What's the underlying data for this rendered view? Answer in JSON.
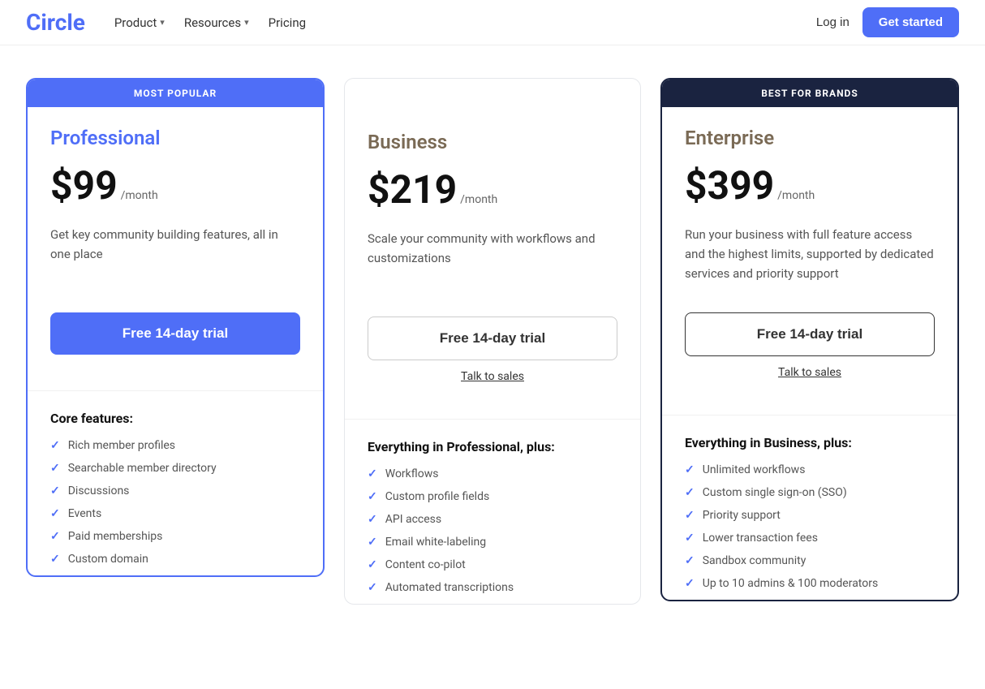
{
  "nav": {
    "logo": "Circle",
    "links": [
      {
        "label": "Product",
        "has_dropdown": true
      },
      {
        "label": "Resources",
        "has_dropdown": true
      },
      {
        "label": "Pricing",
        "has_dropdown": false
      }
    ],
    "login_label": "Log in",
    "get_started_label": "Get started"
  },
  "plans": [
    {
      "id": "professional",
      "badge": "MOST POPULAR",
      "badge_type": "popular",
      "name": "Professional",
      "price": "$99",
      "period": "/month",
      "description": "Get key community building features, all in one place",
      "cta_primary": "Free 14-day trial",
      "cta_type": "primary",
      "talk_to_sales": null,
      "features_heading": "Core features:",
      "features": [
        "Rich member profiles",
        "Searchable member directory",
        "Discussions",
        "Events",
        "Paid memberships",
        "Custom domain"
      ]
    },
    {
      "id": "business",
      "badge": null,
      "badge_type": "none",
      "name": "Business",
      "price": "$219",
      "period": "/month",
      "description": "Scale your community with workflows and customizations",
      "cta_primary": "Free 14-day trial",
      "cta_type": "secondary",
      "talk_to_sales": "Talk to sales",
      "features_heading": "Everything in Professional, plus:",
      "features": [
        "Workflows",
        "Custom profile fields",
        "API access",
        "Email white-labeling",
        "Content co-pilot",
        "Automated transcriptions"
      ]
    },
    {
      "id": "enterprise",
      "badge": "BEST FOR BRANDS",
      "badge_type": "enterprise",
      "name": "Enterprise",
      "price": "$399",
      "period": "/month",
      "description": "Run your business with full feature access and the highest limits, supported by dedicated services and priority support",
      "cta_primary": "Free 14-day trial",
      "cta_type": "enterprise",
      "talk_to_sales": "Talk to sales",
      "features_heading": "Everything in Business, plus:",
      "features": [
        "Unlimited workflows",
        "Custom single sign-on (SSO)",
        "Priority support",
        "Lower transaction fees",
        "Sandbox community",
        "Up to 10 admins & 100 moderators"
      ]
    }
  ]
}
